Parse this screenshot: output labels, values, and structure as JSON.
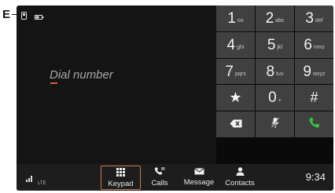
{
  "callout": {
    "label": "E"
  },
  "dialer": {
    "placeholder": "Dial number"
  },
  "keypad": {
    "keys": [
      {
        "digit": "1",
        "letters": "oo"
      },
      {
        "digit": "2",
        "letters": "abc"
      },
      {
        "digit": "3",
        "letters": "def"
      },
      {
        "digit": "4",
        "letters": "ghi"
      },
      {
        "digit": "5",
        "letters": "jkl"
      },
      {
        "digit": "6",
        "letters": "mno"
      },
      {
        "digit": "7",
        "letters": "pqrs"
      },
      {
        "digit": "8",
        "letters": "tuv"
      },
      {
        "digit": "9",
        "letters": "wxyz"
      },
      {
        "symbol": "★"
      },
      {
        "digit": "0",
        "letters": "+"
      },
      {
        "symbol": "#"
      }
    ],
    "backspace_icon": "backspace-icon",
    "mute_icon": "mic-off-icon",
    "call_icon": "phone-icon",
    "call_color": "#3dbb3d"
  },
  "status": {
    "network": "LTE",
    "icons": [
      "phone-connected-icon",
      "battery-icon"
    ]
  },
  "nav": {
    "keypad": "Keypad",
    "calls": "Calls",
    "message": "Message",
    "contacts": "Contacts"
  },
  "clock": "9:34",
  "colors": {
    "accent": "#c7764a",
    "key_bg": "#404040",
    "screen_bg": "#141414"
  }
}
